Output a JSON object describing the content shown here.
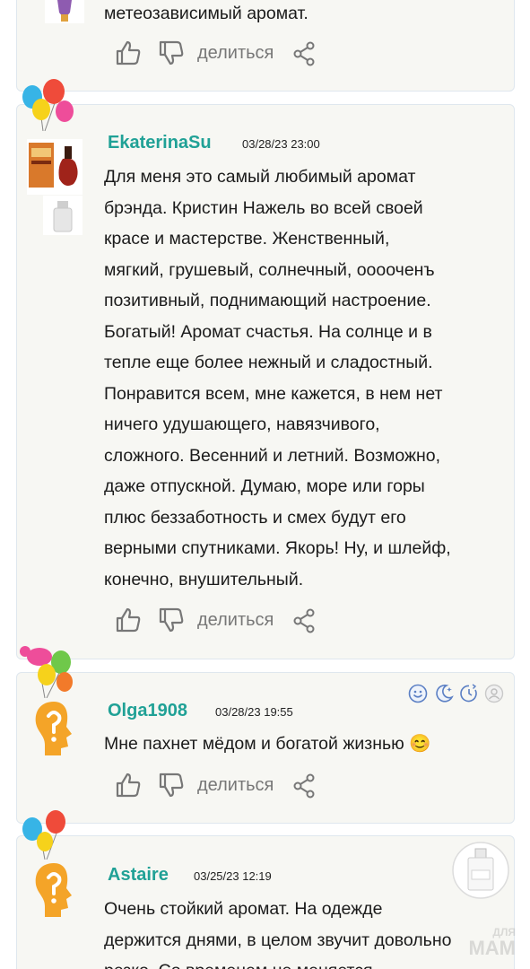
{
  "comments": [
    {
      "text_lines": [
        "метеозависимый аромат."
      ],
      "share_label": "делиться"
    },
    {
      "username": "EkaterinaSu",
      "date": "03/28/23 23:00",
      "text_lines": [
        "Для меня это самый любимый аромат",
        "брэнда. Кристин Нажель во всей своей",
        "красе и мастерстве. Женственный,",
        "мягкий, грушевый, солнечный, ооооченъ",
        "позитивный, поднимающий настроение.",
        "Богатый! Аромат счастья. На солнце и в",
        "тепле еще более нежный и сладостный.",
        "Понравится всем, мне кажется, в нем нет",
        "ничего удушающего, навязчивого,",
        "сложного. Весенний и летний. Возможно,",
        "даже отпускной. Думаю, море или горы",
        "плюс беззаботность и смех будут его",
        "верными спутниками. Якорь! Ну, и шлейф,",
        "конечно, внушительный."
      ],
      "share_label": "делиться"
    },
    {
      "username": "Olga1908",
      "date": "03/28/23 19:55",
      "text_lines": [
        "Мне пахнет мёдом и богатой жизнью 😊"
      ],
      "share_label": "делиться"
    },
    {
      "username": "Astaire",
      "date": "03/25/23 12:19",
      "text_lines": [
        "Очень стойкий аромат. На одежде",
        "держится днями, в целом звучит довольно",
        "резко. Со временем не меняется"
      ]
    }
  ],
  "watermark": {
    "top": "ДЛЯ",
    "bottom": "МАМ"
  },
  "colors": {
    "username": "#20a196",
    "card_bg": "#f7f7f3",
    "card_border": "#dfe7ee",
    "icon_gray": "#777777"
  },
  "icons": [
    "thumbs-up-icon",
    "thumbs-down-icon",
    "share-icon",
    "balloons-icon",
    "question-head-icon",
    "perfume-bottle-icon",
    "smile-icon",
    "moon-icon",
    "clock-icon",
    "person-icon"
  ]
}
